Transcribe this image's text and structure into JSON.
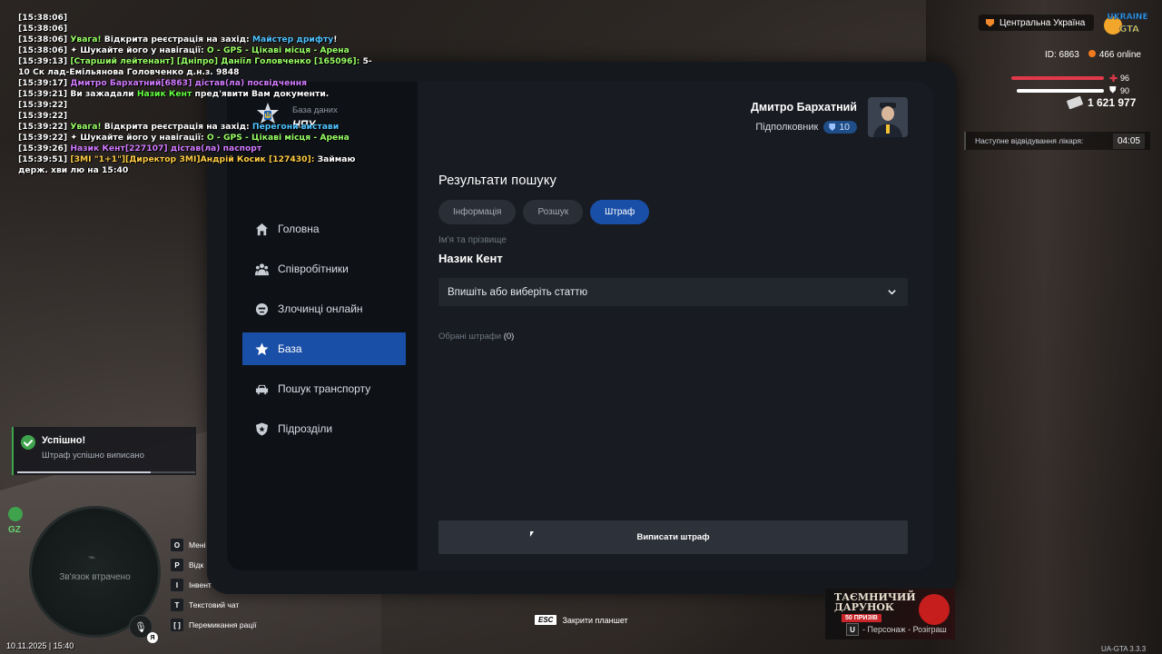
{
  "chat": [
    [
      {
        "t": "[15:38:06]",
        "c": "white"
      }
    ],
    [
      {
        "t": "[15:38:06]",
        "c": "white"
      }
    ],
    [
      {
        "t": "[15:38:06] ",
        "c": "white"
      },
      {
        "t": "Увага!",
        "c": "green"
      },
      {
        "t": " Відкрита реєстрація на захід: ",
        "c": "white"
      },
      {
        "t": "Майстер дрифту",
        "c": "blue"
      },
      {
        "t": "!",
        "c": "white"
      }
    ],
    [
      {
        "t": "[15:38:06] ",
        "c": "white"
      },
      {
        "t": "✦ Шукайте його у навігації: ",
        "c": "white"
      },
      {
        "t": "O - GPS - Цікаві місця - Арена",
        "c": "green"
      }
    ],
    [
      {
        "t": "[15:39:13] ",
        "c": "white"
      },
      {
        "t": "[Старший лейтенант] [Дніпро] Даніїл Головченко [165096]:",
        "c": "green"
      },
      {
        "t": " 5-10 Ск лад-Емільянова Головченко д.н.з. 9848",
        "c": "white"
      }
    ],
    [
      {
        "t": "[15:39:17] ",
        "c": "white"
      },
      {
        "t": "Дмитро Бархатний[6863] дістав(ла) посвідчення",
        "c": "purple"
      }
    ],
    [
      {
        "t": "[15:39:21] ",
        "c": "white"
      },
      {
        "t": "Ви зажадали ",
        "c": "white"
      },
      {
        "t": "Назик Кент",
        "c": "lime"
      },
      {
        "t": " пред'явити Вам документи.",
        "c": "white"
      }
    ],
    [
      {
        "t": "[15:39:22]",
        "c": "white"
      }
    ],
    [
      {
        "t": "[15:39:22]",
        "c": "white"
      }
    ],
    [
      {
        "t": "[15:39:22] ",
        "c": "white"
      },
      {
        "t": "Увага!",
        "c": "green"
      },
      {
        "t": " Відкрита реєстрація на захід: ",
        "c": "white"
      },
      {
        "t": "Перегони вистави",
        "c": "blue"
      }
    ],
    [
      {
        "t": "[15:39:22] ",
        "c": "white"
      },
      {
        "t": "✦ Шукайте його у навігації: ",
        "c": "white"
      },
      {
        "t": "O - GPS - Цікаві місця - Арена",
        "c": "green"
      }
    ],
    [
      {
        "t": "[15:39:26] ",
        "c": "white"
      },
      {
        "t": "Назик Кент[227107] дістав(ла) паспорт",
        "c": "purple"
      }
    ],
    [
      {
        "t": "[15:39:51] ",
        "c": "white"
      },
      {
        "t": "[ЗМІ \"1+1\"][Директор ЗМІ]Андрій Косик [127430]:",
        "c": "gold"
      },
      {
        "t": " Займаю держ. хви лю на 15:40",
        "c": "white"
      }
    ]
  ],
  "hud": {
    "region": "Центральна Україна",
    "logo_text": "UKRAINE GTA",
    "id_text": "ID: 6863",
    "online_text": "466 online",
    "health": 96,
    "armor": 90,
    "money": "1 621 977",
    "doctor_label": "Наступне відвідування лікаря:",
    "doctor_time": "04:05"
  },
  "tablet": {
    "brand_sub": "База даних",
    "brand_name": "НПУ",
    "user_name": "Дмитро Бархатний",
    "user_rank": "Підполковник",
    "user_level": "10",
    "nav": [
      {
        "label": "Головна",
        "icon": "home-icon",
        "active": false
      },
      {
        "label": "Співробітники",
        "icon": "people-icon",
        "active": false
      },
      {
        "label": "Злочинці онлайн",
        "icon": "criminal-icon",
        "active": false
      },
      {
        "label": "База",
        "icon": "star-icon",
        "active": true
      },
      {
        "label": "Пошук транспорту",
        "icon": "car-icon",
        "active": false
      },
      {
        "label": "Підрозділи",
        "icon": "badge-icon",
        "active": false
      }
    ],
    "results_title": "Результати пошуку",
    "tabs": [
      {
        "label": "Інформація",
        "active": false
      },
      {
        "label": "Розшук",
        "active": false
      },
      {
        "label": "Штраф",
        "active": true
      }
    ],
    "name_label": "Ім'я та прізвище",
    "person_name": "Назик Кент",
    "select_placeholder": "Впишіть або виберіть статтю",
    "selected_fines_label": "Обрані штрафи",
    "selected_fines_count": "(0)",
    "submit_label": "Виписати штраф"
  },
  "notification": {
    "title": "Успішно!",
    "message": "Штраф успішно виписано",
    "progress": 0.75
  },
  "minimap": {
    "zone": "GZ",
    "status": "Зв'язок втрачено",
    "mic_key": "Я",
    "datetime": "10.11.2025 | 15:40"
  },
  "hotkeys": [
    {
      "key": "O",
      "label": "Мені"
    },
    {
      "key": "P",
      "label": "Відк"
    },
    {
      "key": "I",
      "label": "Інвент"
    },
    {
      "key": "T",
      "label": "Текстовий чат"
    },
    {
      "key": "[ ]",
      "label": "Перемикання рації"
    }
  ],
  "esc": {
    "key": "ESC",
    "label": "Закрити планшет"
  },
  "promo": {
    "title": "ТАЄМНИЧИЙ ДАРУНОК",
    "badge": "50 ПРИЗІВ",
    "key": "U",
    "label": "- Персонаж - Розіграш"
  },
  "version": "UA-GTA 3.3.3",
  "colors": {
    "accent": "#1a4fa8",
    "success": "#3fa34d",
    "health": "#e0394a",
    "armor": "#ffffff"
  }
}
